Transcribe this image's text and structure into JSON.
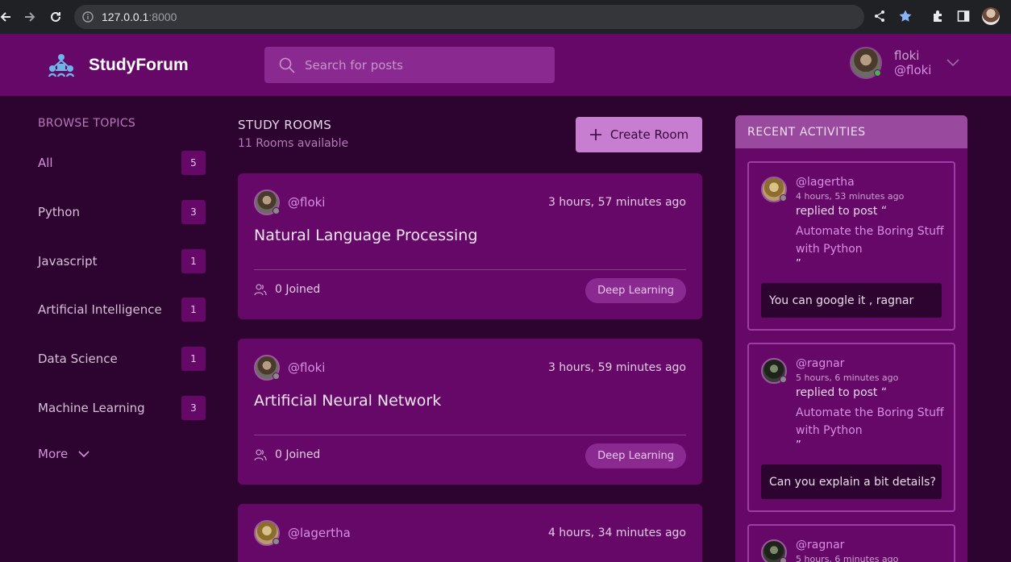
{
  "browser": {
    "url_host": "127.0.0.1",
    "url_port": ":8000"
  },
  "header": {
    "app_name": "StudyForum",
    "search_placeholder": "Search for posts",
    "user_name": "floki",
    "user_handle": "@floki"
  },
  "sidebar": {
    "title": "BROWSE TOPICS",
    "topics": [
      {
        "label": "All",
        "count": "5"
      },
      {
        "label": "Python",
        "count": "3"
      },
      {
        "label": "Javascript",
        "count": "1"
      },
      {
        "label": "Artificial Intelligence",
        "count": "1"
      },
      {
        "label": "Data Science",
        "count": "1"
      },
      {
        "label": "Machine Learning",
        "count": "3"
      }
    ],
    "more_label": "More"
  },
  "rooms": {
    "title": "STUDY ROOMS",
    "count_text": "11 Rooms available",
    "create_label": "Create Room",
    "items": [
      {
        "host": "@floki",
        "time": "3 hours, 57 minutes ago",
        "title": "Natural Language Processing",
        "joined": "0 Joined",
        "tag": "Deep Learning"
      },
      {
        "host": "@floki",
        "time": "3 hours, 59 minutes ago",
        "title": "Artificial Neural Network",
        "joined": "0 Joined",
        "tag": "Deep Learning"
      },
      {
        "host": "@lagertha",
        "time": "4 hours, 34 minutes ago",
        "title": "",
        "joined": "",
        "tag": ""
      }
    ]
  },
  "activities": {
    "title": "RECENT ACTIVITIES",
    "items": [
      {
        "user": "@lagertha",
        "time": "4 hours, 53 minutes ago",
        "action": "replied to post “",
        "post": "Automate the Boring Stuff with Python",
        "quote_end": "”",
        "message": "You can google it , ragnar"
      },
      {
        "user": "@ragnar",
        "time": "5 hours, 6 minutes ago",
        "action": "replied to post “",
        "post": "Automate the Boring Stuff with Python",
        "quote_end": "”",
        "message": "Can you explain a bit details?"
      },
      {
        "user": "@ragnar",
        "time": "5 hours, 6 minutes ago"
      }
    ]
  },
  "colors": {
    "background": "#2d0430",
    "header": "#650868",
    "accent": "#d88fe0",
    "button": "#c77dd0"
  }
}
